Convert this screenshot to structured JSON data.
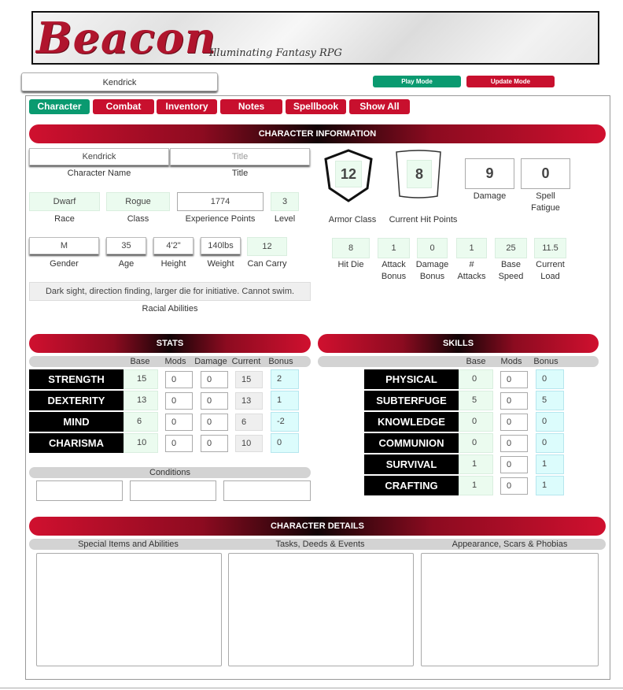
{
  "banner": {
    "logo": "Beacon",
    "tagline": "Illuminating Fantasy RPG"
  },
  "header": {
    "character_name": "Kendrick",
    "play_mode": "Play Mode",
    "update_mode": "Update Mode"
  },
  "tabs": [
    "Character",
    "Combat",
    "Inventory",
    "Notes",
    "Spellbook",
    "Show All"
  ],
  "info": {
    "heading": "CHARACTER INFORMATION",
    "name": {
      "value": "Kendrick",
      "label": "Character Name"
    },
    "title": {
      "placeholder": "Title",
      "label": "Title"
    },
    "race": {
      "value": "Dwarf",
      "label": "Race"
    },
    "class": {
      "value": "Rogue",
      "label": "Class"
    },
    "xp": {
      "value": "1774",
      "label": "Experience Points"
    },
    "level": {
      "value": "3",
      "label": "Level"
    },
    "gender": {
      "value": "M",
      "label": "Gender"
    },
    "age": {
      "value": "35",
      "label": "Age"
    },
    "height": {
      "value": "4'2\"",
      "label": "Height"
    },
    "weight": {
      "value": "140lbs",
      "label": "Weight"
    },
    "carry": {
      "value": "12",
      "label": "Can Carry"
    },
    "racial": {
      "value": "Dark sight, direction finding, larger die for initiative. Cannot swim.",
      "label": "Racial Abilities"
    },
    "armor_class": {
      "value": "12",
      "label": "Armor Class"
    },
    "current_hp": {
      "value": "8",
      "label": "Current Hit Points"
    },
    "damage": {
      "value": "9",
      "label": "Damage"
    },
    "spell_fatigue": {
      "value": "0",
      "label1": "Spell",
      "label2": "Fatigue"
    },
    "hit_die": {
      "value": "8",
      "label1": "Hit Die",
      "label2": ""
    },
    "attack_bonus": {
      "value": "1",
      "label1": "Attack",
      "label2": "Bonus"
    },
    "damage_bonus": {
      "value": "0",
      "label1": "Damage",
      "label2": "Bonus"
    },
    "attacks": {
      "value": "1",
      "label1": "#",
      "label2": "Attacks"
    },
    "base_speed": {
      "value": "25",
      "label1": "Base",
      "label2": "Speed"
    },
    "current_load": {
      "value": "11.5",
      "label1": "Current",
      "label2": "Load"
    }
  },
  "stats": {
    "heading": "STATS",
    "columns": {
      "base": "Base",
      "mods": "Mods",
      "damage": "Damage",
      "current": "Current",
      "bonus": "Bonus"
    },
    "rows": [
      {
        "name": "STRENGTH",
        "base": "15",
        "mods": "0",
        "damage": "0",
        "current": "15",
        "bonus": "2"
      },
      {
        "name": "DEXTERITY",
        "base": "13",
        "mods": "0",
        "damage": "0",
        "current": "13",
        "bonus": "1"
      },
      {
        "name": "MIND",
        "base": "6",
        "mods": "0",
        "damage": "0",
        "current": "6",
        "bonus": "-2"
      },
      {
        "name": "CHARISMA",
        "base": "10",
        "mods": "0",
        "damage": "0",
        "current": "10",
        "bonus": "0"
      }
    ],
    "conditions": "Conditions"
  },
  "skills": {
    "heading": "SKILLS",
    "columns": {
      "base": "Base",
      "mods": "Mods",
      "bonus": "Bonus"
    },
    "rows": [
      {
        "name": "PHYSICAL",
        "base": "0",
        "mods": "0",
        "bonus": "0"
      },
      {
        "name": "SUBTERFUGE",
        "base": "5",
        "mods": "0",
        "bonus": "5"
      },
      {
        "name": "KNOWLEDGE",
        "base": "0",
        "mods": "0",
        "bonus": "0"
      },
      {
        "name": "COMMUNION",
        "base": "0",
        "mods": "0",
        "bonus": "0"
      },
      {
        "name": "SURVIVAL",
        "base": "1",
        "mods": "0",
        "bonus": "1"
      },
      {
        "name": "CRAFTING",
        "base": "1",
        "mods": "0",
        "bonus": "1"
      }
    ]
  },
  "details": {
    "heading": "CHARACTER DETAILS",
    "special": "Special Items and Abilities",
    "tasks": "Tasks, Deeds & Events",
    "appearance": "Appearance, Scars & Phobias"
  },
  "colors": {
    "accent_red": "#c8102e",
    "accent_green": "#0a9a70",
    "field_green": "#ebfbef",
    "field_cyan": "#dcfcfc"
  }
}
